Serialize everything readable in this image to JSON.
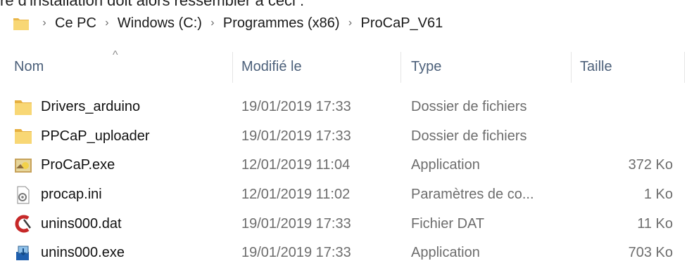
{
  "fragment_text": "re d'installation doit alors ressembler à ceci :",
  "breadcrumb": [
    "Ce PC",
    "Windows (C:)",
    "Programmes (x86)",
    "ProCaP_V61"
  ],
  "columns": {
    "name": "Nom",
    "modified": "Modifié le",
    "type": "Type",
    "size": "Taille"
  },
  "files": [
    {
      "name": "Drivers_arduino",
      "modified": "19/01/2019 17:33",
      "type": "Dossier de fichiers",
      "size": "",
      "icon": "folder-icon"
    },
    {
      "name": "PPCaP_uploader",
      "modified": "19/01/2019 17:33",
      "type": "Dossier de fichiers",
      "size": "",
      "icon": "folder-icon"
    },
    {
      "name": "ProCaP.exe",
      "modified": "12/01/2019 11:04",
      "type": "Application",
      "size": "372 Ko",
      "icon": "app-image-icon"
    },
    {
      "name": "procap.ini",
      "modified": "12/01/2019 11:02",
      "type": "Paramètres de co...",
      "size": "1 Ko",
      "icon": "settings-file-icon"
    },
    {
      "name": "unins000.dat",
      "modified": "19/01/2019 17:33",
      "type": "Fichier DAT",
      "size": "11 Ko",
      "icon": "dat-file-icon"
    },
    {
      "name": "unins000.exe",
      "modified": "19/01/2019 17:33",
      "type": "Application",
      "size": "703 Ko",
      "icon": "installer-icon"
    }
  ]
}
